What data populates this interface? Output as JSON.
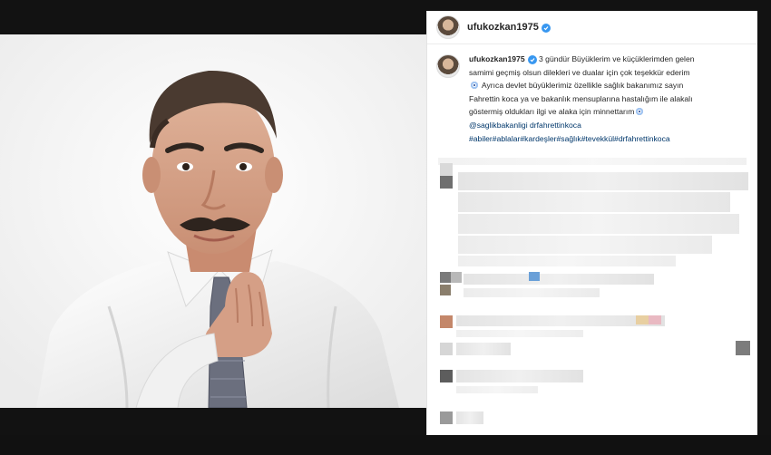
{
  "post": {
    "username": "ufukozkan1975",
    "caption": {
      "username": "ufukozkan1975",
      "line1": " 3 gündür Büyüklerim ve küçüklerimden gelen",
      "line2": "samimi geçmiş olsun dilekleri ve dualar için çok teşekkür ederim",
      "line3": " Ayrıca devlet büyüklerimiz özellikle sağlık bakanımız sayın",
      "line4": "Fahrettin koca ya ve bakanlık mensuplarına hastalığım ile alakalı",
      "line5": "göstermiş oldukları ilgi ve alaka için minnettarım",
      "mentions": "@saglikbakanligi drfahrettinkoca",
      "hashtags": "#abiler#ablalar#kardeşler#sağlık#tevekkül#drfahrettinkoca"
    }
  },
  "colors": {
    "background": "#121212",
    "panel": "#ffffff",
    "link": "#00376b",
    "verified": "#3897f0"
  },
  "icons": {
    "verified": "verified-badge-icon",
    "nazar": "nazar-eye-icon"
  }
}
